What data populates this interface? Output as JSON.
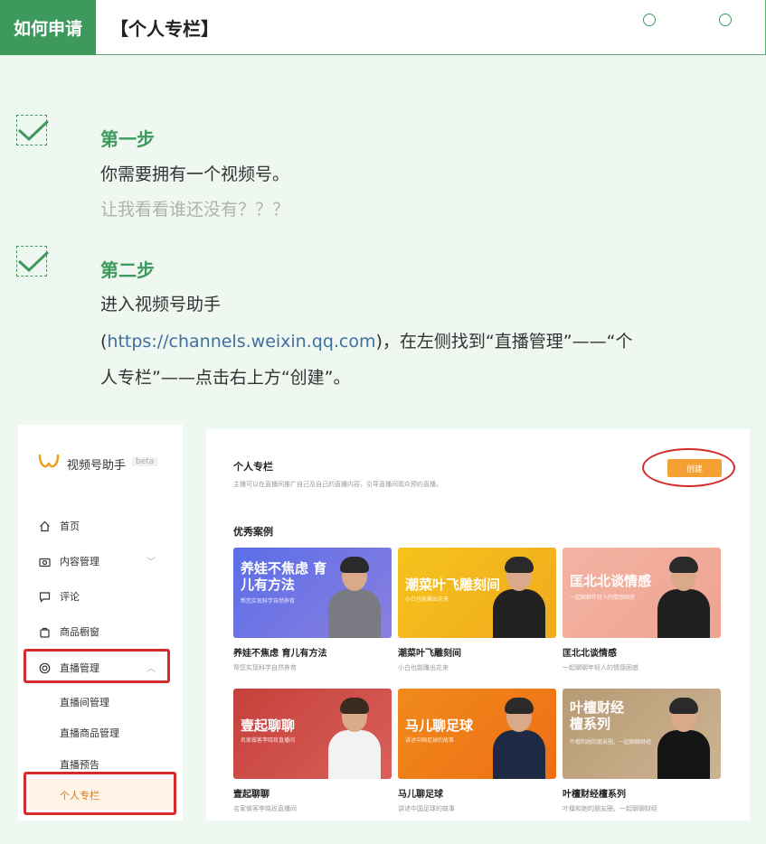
{
  "header": {
    "tag": "如何申请",
    "title": "【个人专栏】"
  },
  "colors": {
    "brand_green": "#3d9a5c",
    "highlight_red": "#d42a2a",
    "accent_orange": "#f5a032"
  },
  "steps": [
    {
      "title": "第一步",
      "line1": "你需要拥有一个视频号。",
      "line2": "让我看看谁还没有？？？"
    },
    {
      "title": "第二步",
      "line1": "进入视频号助手",
      "line2_open": "(",
      "line2_link": "https://channels.weixin.qq.com",
      "line2_rest": ")，在左侧找到“直播管理”——“个",
      "line3": "人专栏”——点击右上方“创建”。"
    }
  ],
  "screenshot": {
    "app_name": "视频号助手",
    "beta": "beta",
    "nav": [
      {
        "label": "首页",
        "icon": "home-icon"
      },
      {
        "label": "内容管理",
        "icon": "camera-icon"
      },
      {
        "label": "评论",
        "icon": "comment-icon"
      },
      {
        "label": "商品橱窗",
        "icon": "bag-icon"
      },
      {
        "label": "直播管理",
        "icon": "live-icon"
      }
    ],
    "live_sub": [
      "直播间管理",
      "直播商品管理",
      "直播预告",
      "个人专栏"
    ],
    "main": {
      "title": "个人专栏",
      "desc": "主播可以在直播间推广自己及自己的直播内容，引导直播间观众预约直播。",
      "create": "创建",
      "cases_title": "优秀案例",
      "cards": [
        {
          "big": "养娃不焦虑 育儿有方法",
          "small": "帮您实现科学自然养育",
          "name": "养娃不焦虑 育儿有方法",
          "desc": "帮您实现科学自然养育"
        },
        {
          "big": "潮菜叶飞雕刻间",
          "small": "小白也能雕出花来",
          "name": "潮菜叶飞雕刻间",
          "desc": "小白也能雕出花来"
        },
        {
          "big": "匡北北谈情感",
          "small": "一起聊聊年轻人的情感困惑",
          "name": "匡北北谈情感",
          "desc": "一起聊聊年轻人的情感困惑"
        },
        {
          "big": "壹起聊聊",
          "small": "名家做客李晓玫直播间",
          "name": "壹起聊聊",
          "desc": "名家做客李晓玫直播间"
        },
        {
          "big": "马儿聊足球",
          "small": "讲述中国足球的故事",
          "name": "马儿聊足球",
          "desc": "讲述中国足球的故事"
        },
        {
          "big": "叶檀财经檀系列",
          "small": "叶檀和她的朋友圈，一起聊聊财经",
          "name": "叶檀财经檀系列",
          "desc": "叶檀和她的朋友圈，一起聊聊财经"
        }
      ]
    }
  }
}
